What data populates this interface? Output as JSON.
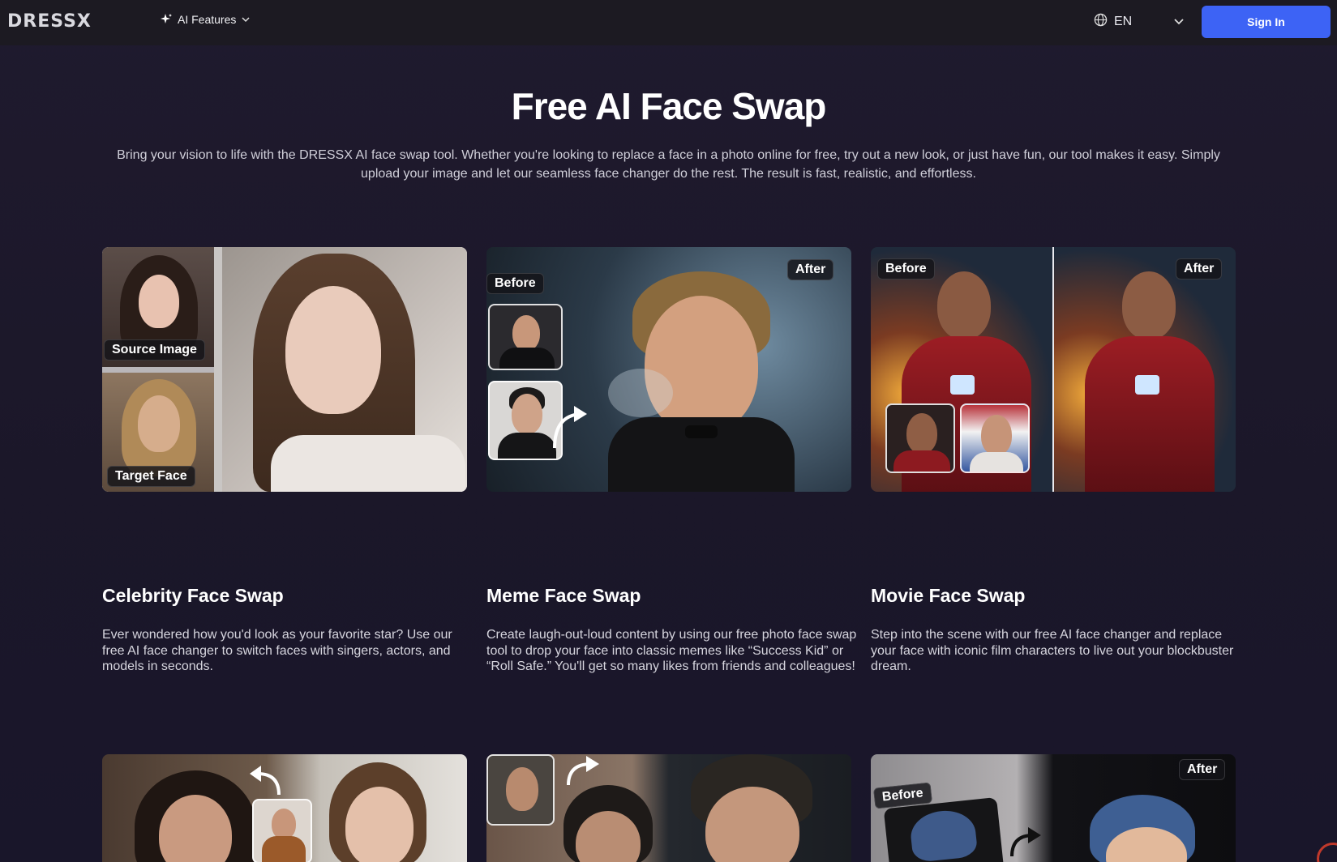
{
  "header": {
    "logo": "DRESSX",
    "ai_features_label": "AI Features",
    "language": "EN",
    "sign_in_label": "Sign In",
    "accent_color": "#3d63f5"
  },
  "hero": {
    "title": "Free AI Face Swap",
    "description": "Bring your vision to life with the DRESSX AI face swap tool. Whether you're looking to replace a face in a photo online for free, try out a new look, or just have fun, our tool makes it easy. Simply upload your image and let our seamless face changer do the rest. The result is fast, realistic, and effortless."
  },
  "cards": [
    {
      "title": "Celebrity Face Swap",
      "description": "Ever wondered how you'd look as your favorite star? Use our free AI face changer to switch faces with singers, actors, and models in seconds.",
      "tags": [
        "Source Image",
        "Target Face"
      ]
    },
    {
      "title": "Meme Face Swap",
      "description": "Create laugh-out-loud content by using our free photo face swap tool to drop your face into classic memes like “Success Kid” or “Roll Safe.” You'll get so many likes from friends and colleagues!",
      "tags": [
        "Before",
        "After"
      ]
    },
    {
      "title": "Movie Face Swap",
      "description": "Step into the scene with our free AI face changer and replace your face with iconic film characters to live out your blockbuster dream.",
      "tags": [
        "Before",
        "After"
      ]
    },
    {
      "tags": []
    },
    {
      "tags": []
    },
    {
      "tags": [
        "Before",
        "After"
      ]
    }
  ]
}
